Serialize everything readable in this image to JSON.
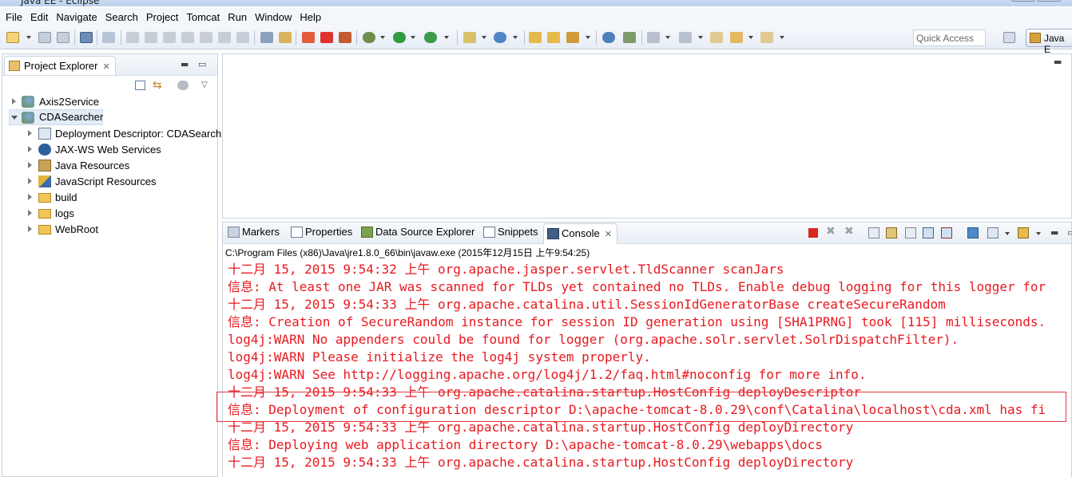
{
  "window": {
    "title": "Java EE - Eclipse"
  },
  "menu": [
    "File",
    "Edit",
    "Navigate",
    "Search",
    "Project",
    "Tomcat",
    "Run",
    "Window",
    "Help"
  ],
  "toolbar": {
    "quick_access": "Quick Access",
    "perspective": "Java E",
    "icons": [
      "new-icon",
      "save-icon",
      "save-all-icon",
      "print-icon",
      "skip-breakpoints-icon",
      "resume-icon",
      "suspend-icon",
      "terminate-icon",
      "disconnect-icon",
      "step-into-icon",
      "step-over-icon",
      "step-return-icon",
      "open-console-icon",
      "toggle-icon",
      "build-icon",
      "clean-icon",
      "debug-icon",
      "run-icon",
      "run-config-icon",
      "new-server-icon",
      "new-web-service-icon",
      "open-type-icon",
      "open-task-icon",
      "search-icon",
      "globe-icon",
      "annotation-icon",
      "back-icon",
      "forward-icon"
    ]
  },
  "explorer": {
    "tab_label": "Project Explorer",
    "tree": [
      {
        "label": "Axis2Service",
        "level": 0,
        "expanded": false,
        "icon": "web-project-icon"
      },
      {
        "label": "CDASearcher",
        "level": 0,
        "expanded": true,
        "selected": true,
        "icon": "web-project-icon"
      },
      {
        "label": "Deployment Descriptor: CDASearch",
        "level": 1,
        "expanded": false,
        "icon": "deployment-descriptor-icon"
      },
      {
        "label": "JAX-WS Web Services",
        "level": 1,
        "expanded": false,
        "icon": "web-services-icon"
      },
      {
        "label": "Java Resources",
        "level": 1,
        "expanded": false,
        "icon": "java-resources-icon"
      },
      {
        "label": "JavaScript Resources",
        "level": 1,
        "expanded": false,
        "icon": "javascript-resources-icon"
      },
      {
        "label": "build",
        "level": 1,
        "expanded": false,
        "icon": "folder-icon"
      },
      {
        "label": "logs",
        "level": 1,
        "expanded": false,
        "icon": "folder-icon"
      },
      {
        "label": "WebRoot",
        "level": 1,
        "expanded": false,
        "icon": "folder-icon"
      }
    ]
  },
  "bottom_tabs": [
    {
      "label": "Markers",
      "icon": "markers-icon",
      "active": false
    },
    {
      "label": "Properties",
      "icon": "properties-icon",
      "active": false
    },
    {
      "label": "Data Source Explorer",
      "icon": "data-source-icon",
      "active": false
    },
    {
      "label": "Snippets",
      "icon": "snippets-icon",
      "active": false
    },
    {
      "label": "Console",
      "icon": "console-icon",
      "active": true
    }
  ],
  "console": {
    "process": "C:\\Program Files (x86)\\Java\\jre1.8.0_66\\bin\\javaw.exe (2015年12月15日 上午9:54:25)",
    "lines": [
      "十二月 15, 2015 9:54:32 上午 org.apache.jasper.servlet.TldScanner scanJars",
      "信息: At least one JAR was scanned for TLDs yet contained no TLDs. Enable debug logging for this logger for",
      "十二月 15, 2015 9:54:33 上午 org.apache.catalina.util.SessionIdGeneratorBase createSecureRandom",
      "信息: Creation of SecureRandom instance for session ID generation using [SHA1PRNG] took [115] milliseconds.",
      "log4j:WARN No appenders could be found for logger (org.apache.solr.servlet.SolrDispatchFilter).",
      "log4j:WARN Please initialize the log4j system properly.",
      "log4j:WARN See http://logging.apache.org/log4j/1.2/faq.html#noconfig for more info.",
      "十二月 15, 2015 9:54:33 上午 org.apache.catalina.startup.HostConfig deployDescriptor",
      "信息: Deployment of configuration descriptor D:\\apache-tomcat-8.0.29\\conf\\Catalina\\localhost\\cda.xml has fi",
      "十二月 15, 2015 9:54:33 上午 org.apache.catalina.startup.HostConfig deployDirectory",
      "信息: Deploying web application directory D:\\apache-tomcat-8.0.29\\webapps\\docs",
      "十二月 15, 2015 9:54:33 上午 org.apache.catalina.startup.HostConfig deployDirectory"
    ],
    "text_color": "#e8191f",
    "highlight_color": "#e13a3f"
  }
}
